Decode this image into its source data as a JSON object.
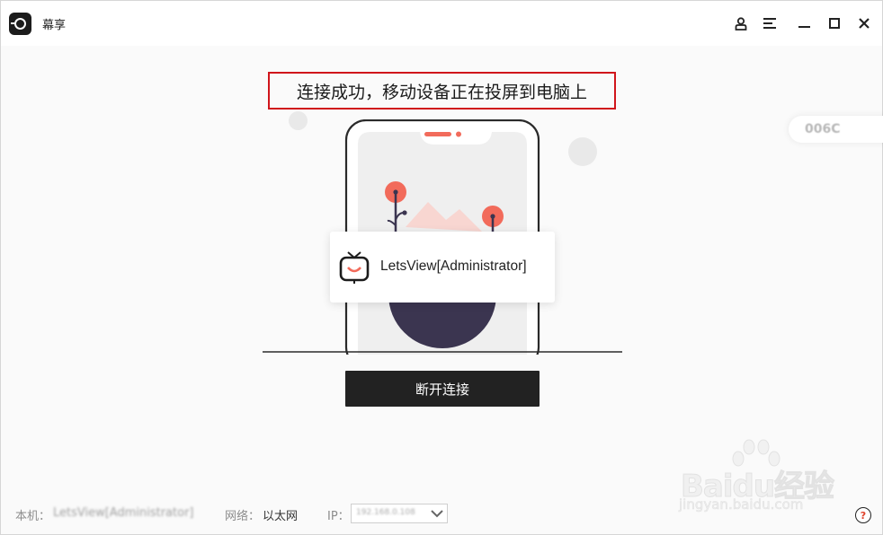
{
  "titlebar": {
    "app_name": "幕享",
    "icons": [
      "user-icon",
      "menu-icon",
      "minimize-icon",
      "maximize-icon",
      "close-icon"
    ]
  },
  "main": {
    "headline": "连接成功，移动设备正在投屏到电脑上",
    "device_name": "LetsView[Administrator]",
    "disconnect_label": "断开连接",
    "side_badge": "006C"
  },
  "statusbar": {
    "host_label": "本机：",
    "host_value": "LetsView[Administrator]",
    "network_label": "网络：",
    "network_value": "以太网",
    "ip_label": "IP：",
    "ip_value": "192.168.0.108"
  },
  "watermark": {
    "brand": "Baidu经验",
    "url": "jingyan.baidu.com"
  },
  "colors": {
    "accent_red": "#d0151b",
    "button_dark": "#222222",
    "illustration_coral": "#f26b5b",
    "illustration_navy": "#3b3550"
  }
}
